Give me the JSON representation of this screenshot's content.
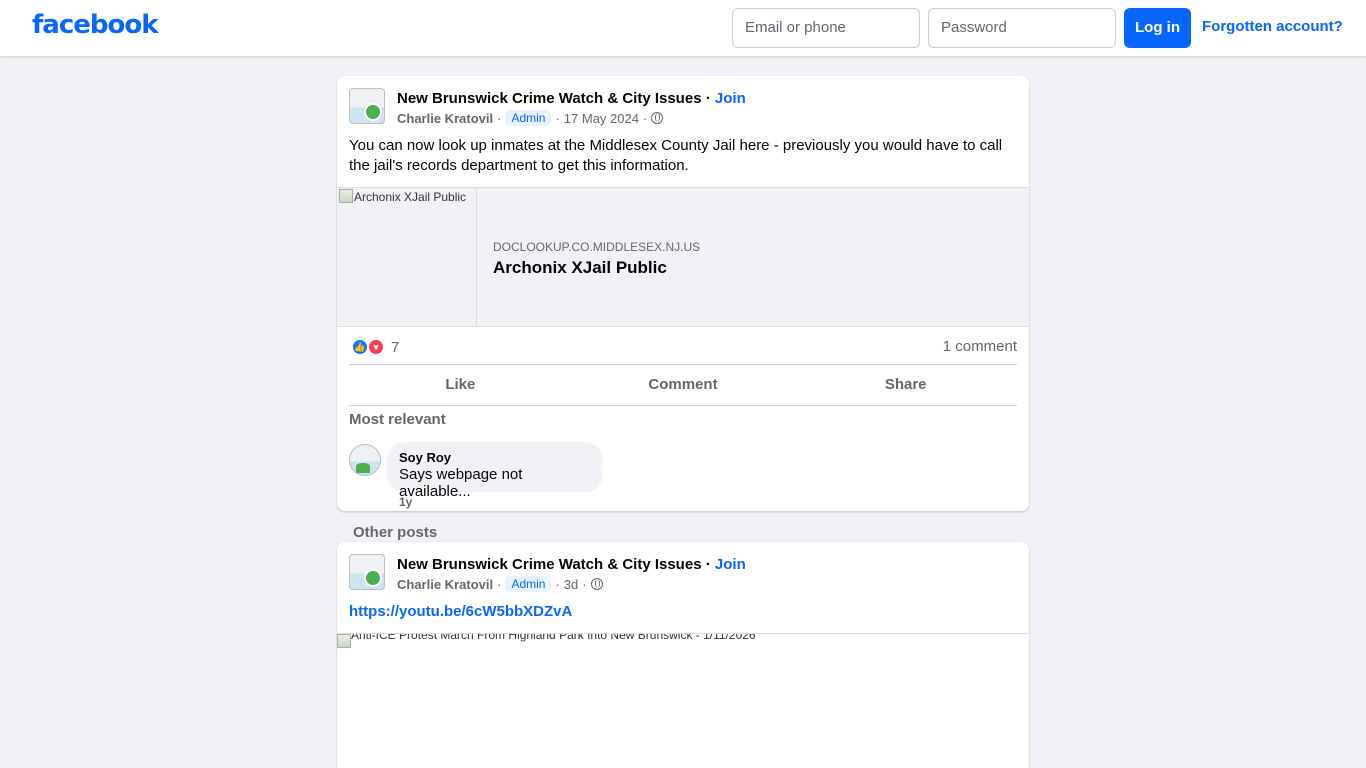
{
  "header": {
    "logo": "facebook",
    "email_placeholder": "Email or phone",
    "password_placeholder": "Password",
    "login_label": "Log in",
    "forgot_label": "Forgotten account?"
  },
  "posts": [
    {
      "group": "New Brunswick Crime Watch & City Issues",
      "join": "Join",
      "author": "Charlie Kratovil",
      "role": "Admin",
      "date": "17 May 2024",
      "text": "You can now look up inmates at the Middlesex County Jail here - previously you would have to call the jail's records department to get this information.",
      "link_preview": {
        "image_alt": "Archonix XJail Public",
        "domain": "DOCLOOKUP.CO.MIDDLESEX.NJ.US",
        "title": "Archonix XJail Public"
      },
      "reaction_count": "7",
      "comment_count": "1 comment",
      "actions": [
        "Like",
        "Comment",
        "Share"
      ],
      "comments_sort": "Most relevant",
      "comments": [
        {
          "author": "Soy Roy",
          "text": "Says webpage not available...",
          "time": "1y"
        }
      ]
    },
    {
      "group": "New Brunswick Crime Watch & City Issues",
      "join": "Join",
      "author": "Charlie Kratovil",
      "role": "Admin",
      "date": "3d",
      "link": "https://youtu.be/6cW5bbXDZvA",
      "media_alt": "Anti-ICE Protest March From Highland Park Into New Brunswick - 1/11/2026"
    }
  ],
  "other_posts_label": "Other posts",
  "icons": {
    "reaction_like": "like-reaction-icon",
    "reaction_love": "love-reaction-icon",
    "privacy": "globe-icon"
  },
  "colors": {
    "brand": "#0866ff",
    "background": "#f0f2f5",
    "like": "#1877f2",
    "love": "#f33e58"
  }
}
